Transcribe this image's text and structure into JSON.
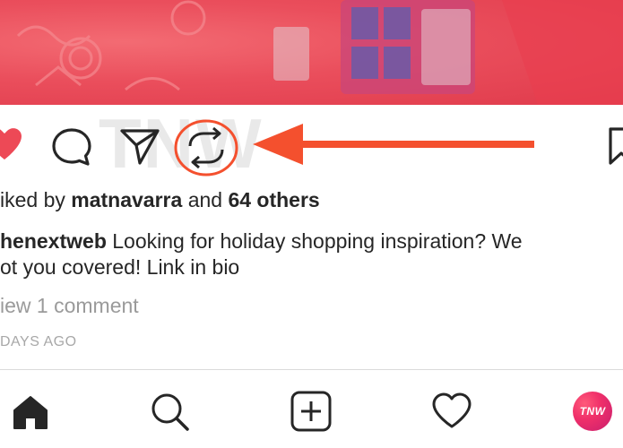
{
  "post": {
    "likes_prefix": "iked by",
    "liker_name": "matnavarra",
    "likes_join": "and",
    "likes_count_text": "64 others",
    "author": "henextweb",
    "caption_line1": " Looking for holiday shopping inspiration? We",
    "caption_line2": "ot you covered! Link in bio",
    "comments_link": "iew 1 comment",
    "timestamp": "DAYS AGO"
  },
  "actions": {
    "like_icon": "heart-filled-icon",
    "comment_icon": "comment-bubble-icon",
    "share_icon": "paper-plane-icon",
    "repost_icon": "repost-icon",
    "save_icon": "bookmark-icon",
    "annotation_arrow": "arrow-pointer",
    "annotation_color": "#f4502e"
  },
  "watermark": {
    "text": "TNW"
  },
  "bottom_nav": {
    "items": [
      "home-icon",
      "search-icon",
      "new-post-icon",
      "activity-heart-icon",
      "profile-avatar"
    ],
    "avatar_text": "TNW"
  },
  "colors": {
    "like_red": "#ed4956",
    "banner": "#e8485a",
    "accent_orange": "#f4502e",
    "muted_text": "#9a9a9a"
  }
}
